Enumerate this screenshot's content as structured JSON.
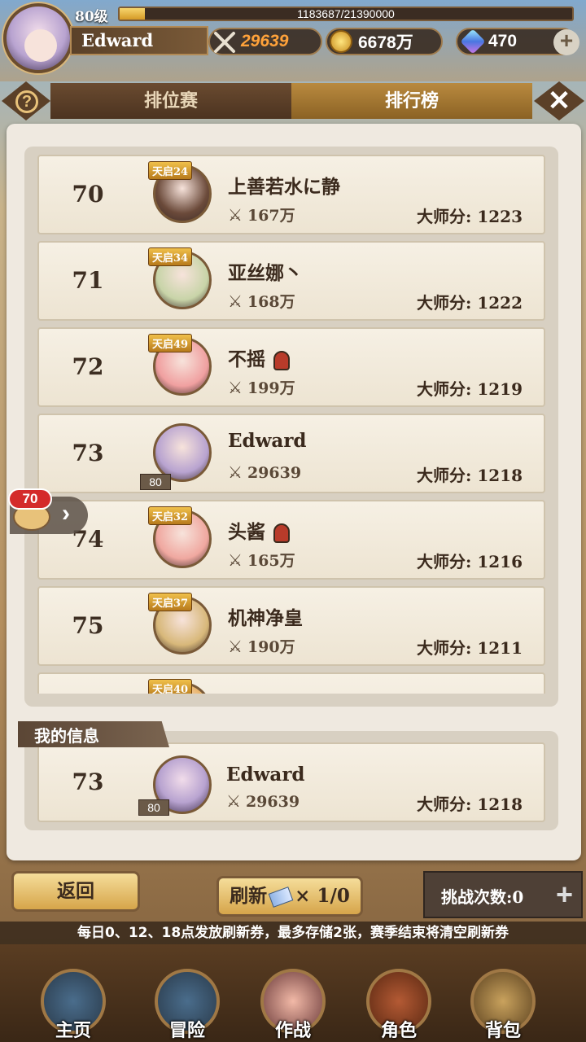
{
  "player": {
    "level": "80级",
    "exp_text": "1183687/21390000",
    "exp_fraction": 0.055,
    "name": "Edward",
    "power": "29639",
    "gold": "6678万",
    "gems": "470"
  },
  "tabs": [
    {
      "label": "排位赛",
      "active": false
    },
    {
      "label": "排行榜",
      "active": true
    }
  ],
  "ranking": [
    {
      "rank": "70",
      "badge": "天启24",
      "name": "上善若水に静",
      "helmet": false,
      "power": "167万",
      "score": "大师分: 1223",
      "avatar_color": "#6b4a3a",
      "level_badge": ""
    },
    {
      "rank": "71",
      "badge": "天启34",
      "name": "亚丝娜丶",
      "helmet": false,
      "power": "168万",
      "score": "大师分: 1222",
      "avatar_color": "#c8d4a8",
      "level_badge": ""
    },
    {
      "rank": "72",
      "badge": "天启49",
      "name": "不摇",
      "helmet": true,
      "power": "199万",
      "score": "大师分: 1219",
      "avatar_color": "#f0a0a0",
      "level_badge": ""
    },
    {
      "rank": "73",
      "badge": "",
      "name": "Edward",
      "helmet": false,
      "power": "29639",
      "score": "大师分: 1218",
      "avatar_color": "#b8a3d0",
      "level_badge": "80"
    },
    {
      "rank": "74",
      "badge": "天启32",
      "name": "头酱",
      "helmet": true,
      "power": "165万",
      "score": "大师分: 1216",
      "avatar_color": "#f0a8a0",
      "level_badge": ""
    },
    {
      "rank": "75",
      "badge": "天启37",
      "name": "机神净皇",
      "helmet": false,
      "power": "190万",
      "score": "大师分: 1211",
      "avatar_color": "#d8b87a",
      "level_badge": ""
    },
    {
      "rank": "",
      "badge": "天启40",
      "name": "",
      "helmet": false,
      "power": "",
      "score": "",
      "avatar_color": "#e8b060",
      "level_badge": ""
    }
  ],
  "chat": {
    "count": "70"
  },
  "my_info": {
    "label": "我的信息",
    "rank": "73",
    "name": "Edward",
    "level_badge": "80",
    "power": "29639",
    "score": "大师分: 1218"
  },
  "buttons": {
    "back": "返回",
    "refresh": "刷新",
    "refresh_count": "× 1/0",
    "challenge": "挑战次数:0"
  },
  "notice": "每日0、12、18点发放刷新券，最多存储2张，赛季结束将清空刷新券",
  "nav": [
    {
      "label": "主页",
      "icon": "statue-icon"
    },
    {
      "label": "冒险",
      "icon": "portal-icon"
    },
    {
      "label": "作战",
      "icon": "sword-girl-icon"
    },
    {
      "label": "角色",
      "icon": "book-icon"
    },
    {
      "label": "背包",
      "icon": "backpack-icon"
    }
  ]
}
